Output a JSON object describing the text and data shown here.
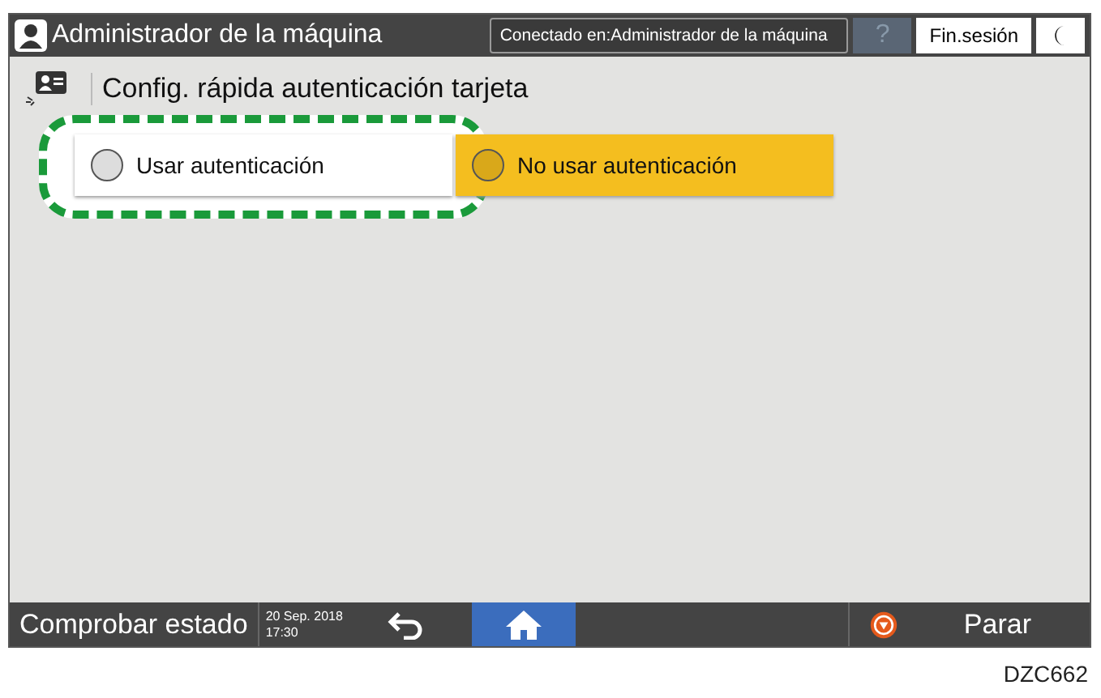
{
  "header": {
    "title": "Administrador de la máquina",
    "connection": "Conectado en:Administrador de la máquina",
    "help": "?",
    "logout": "Fin.sesión"
  },
  "screen_title": "Config. rápida autenticación tarjeta",
  "options": [
    {
      "label": "Usar autenticación",
      "selected": false,
      "highlighted": true
    },
    {
      "label": "No usar autenticación",
      "selected": true,
      "highlighted": false
    }
  ],
  "footer": {
    "status": "Comprobar estado",
    "date": "20 Sep. 2018",
    "time": "17:30",
    "stop": "Parar"
  },
  "figure_id": "DZC662"
}
